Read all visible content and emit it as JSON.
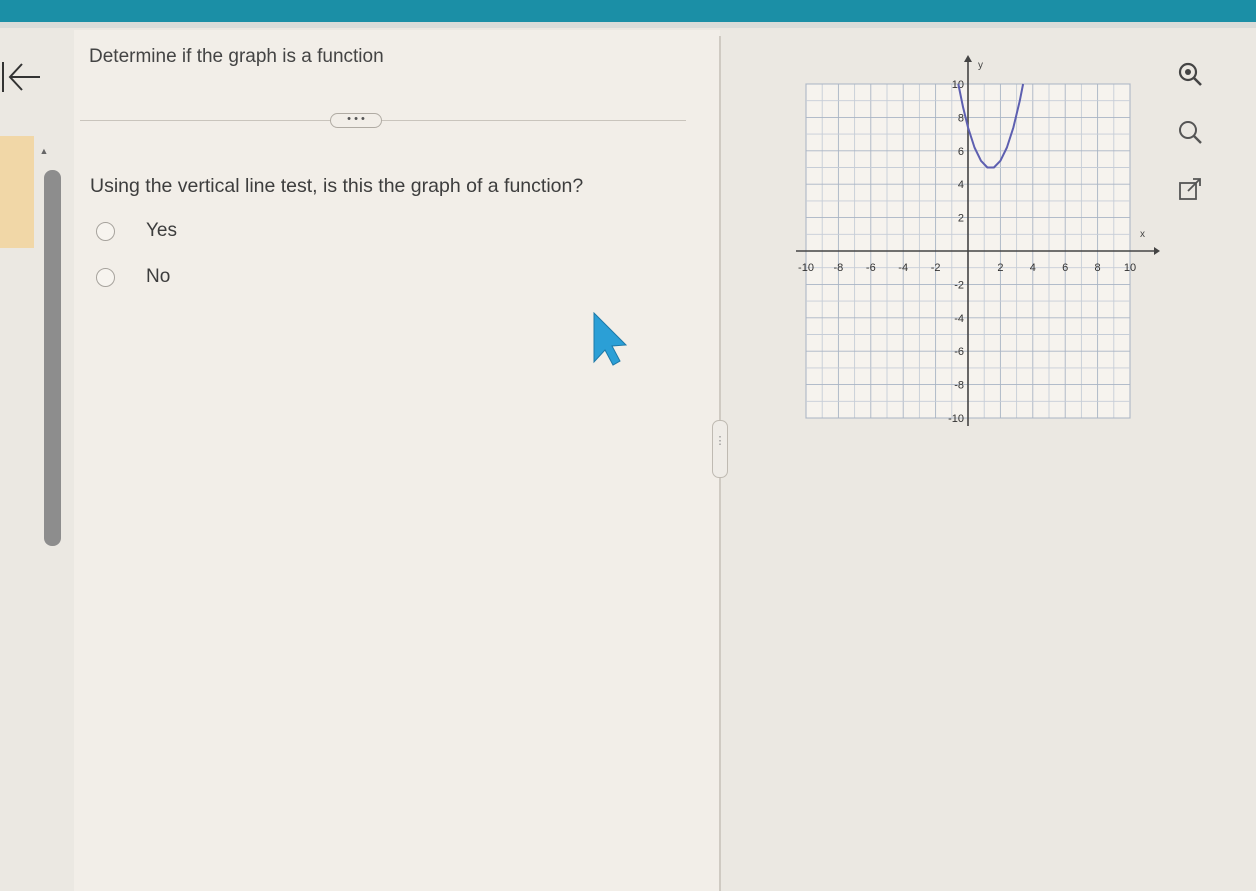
{
  "question": {
    "title": "Determine if the graph is a function",
    "more_label": "• • •",
    "prompt": "Using the vertical line test, is this the graph of a function?",
    "options": [
      {
        "label": "Yes"
      },
      {
        "label": "No"
      }
    ]
  },
  "graph": {
    "x_axis_label": "x",
    "y_axis_label": "y",
    "x_tick_labels": [
      "-10",
      "-8",
      "-6",
      "-4",
      "-2",
      "2",
      "4",
      "6",
      "8",
      "10"
    ],
    "y_tick_labels": [
      "10",
      "8",
      "6",
      "4",
      "2",
      "-2",
      "-4",
      "-6",
      "-8",
      "-10"
    ]
  },
  "chart_data": {
    "type": "line",
    "xlim": [
      -10,
      10
    ],
    "ylim": [
      -10,
      10
    ],
    "grid": true,
    "series": [
      {
        "x": [
          -0.6,
          -0.3,
          0,
          0.4,
          0.8,
          1.2,
          1.6,
          2.0,
          2.4,
          2.8,
          3.2,
          3.4
        ],
        "y": [
          10.0,
          8.6,
          7.4,
          6.2,
          5.4,
          5.0,
          5.0,
          5.4,
          6.2,
          7.4,
          9.0,
          10.0
        ]
      }
    ]
  },
  "colors": {
    "topbar": "#1b8fa6",
    "curve": "#5d5fb0",
    "cursor": "#2b9fd6",
    "side_tab": "#f1d7a7"
  },
  "icons": {
    "back": "back-arrow-icon",
    "zoom_in": "zoom-in-icon",
    "zoom_out": "zoom-out-icon",
    "popout": "popout-icon",
    "cursor": "mouse-cursor-icon"
  }
}
